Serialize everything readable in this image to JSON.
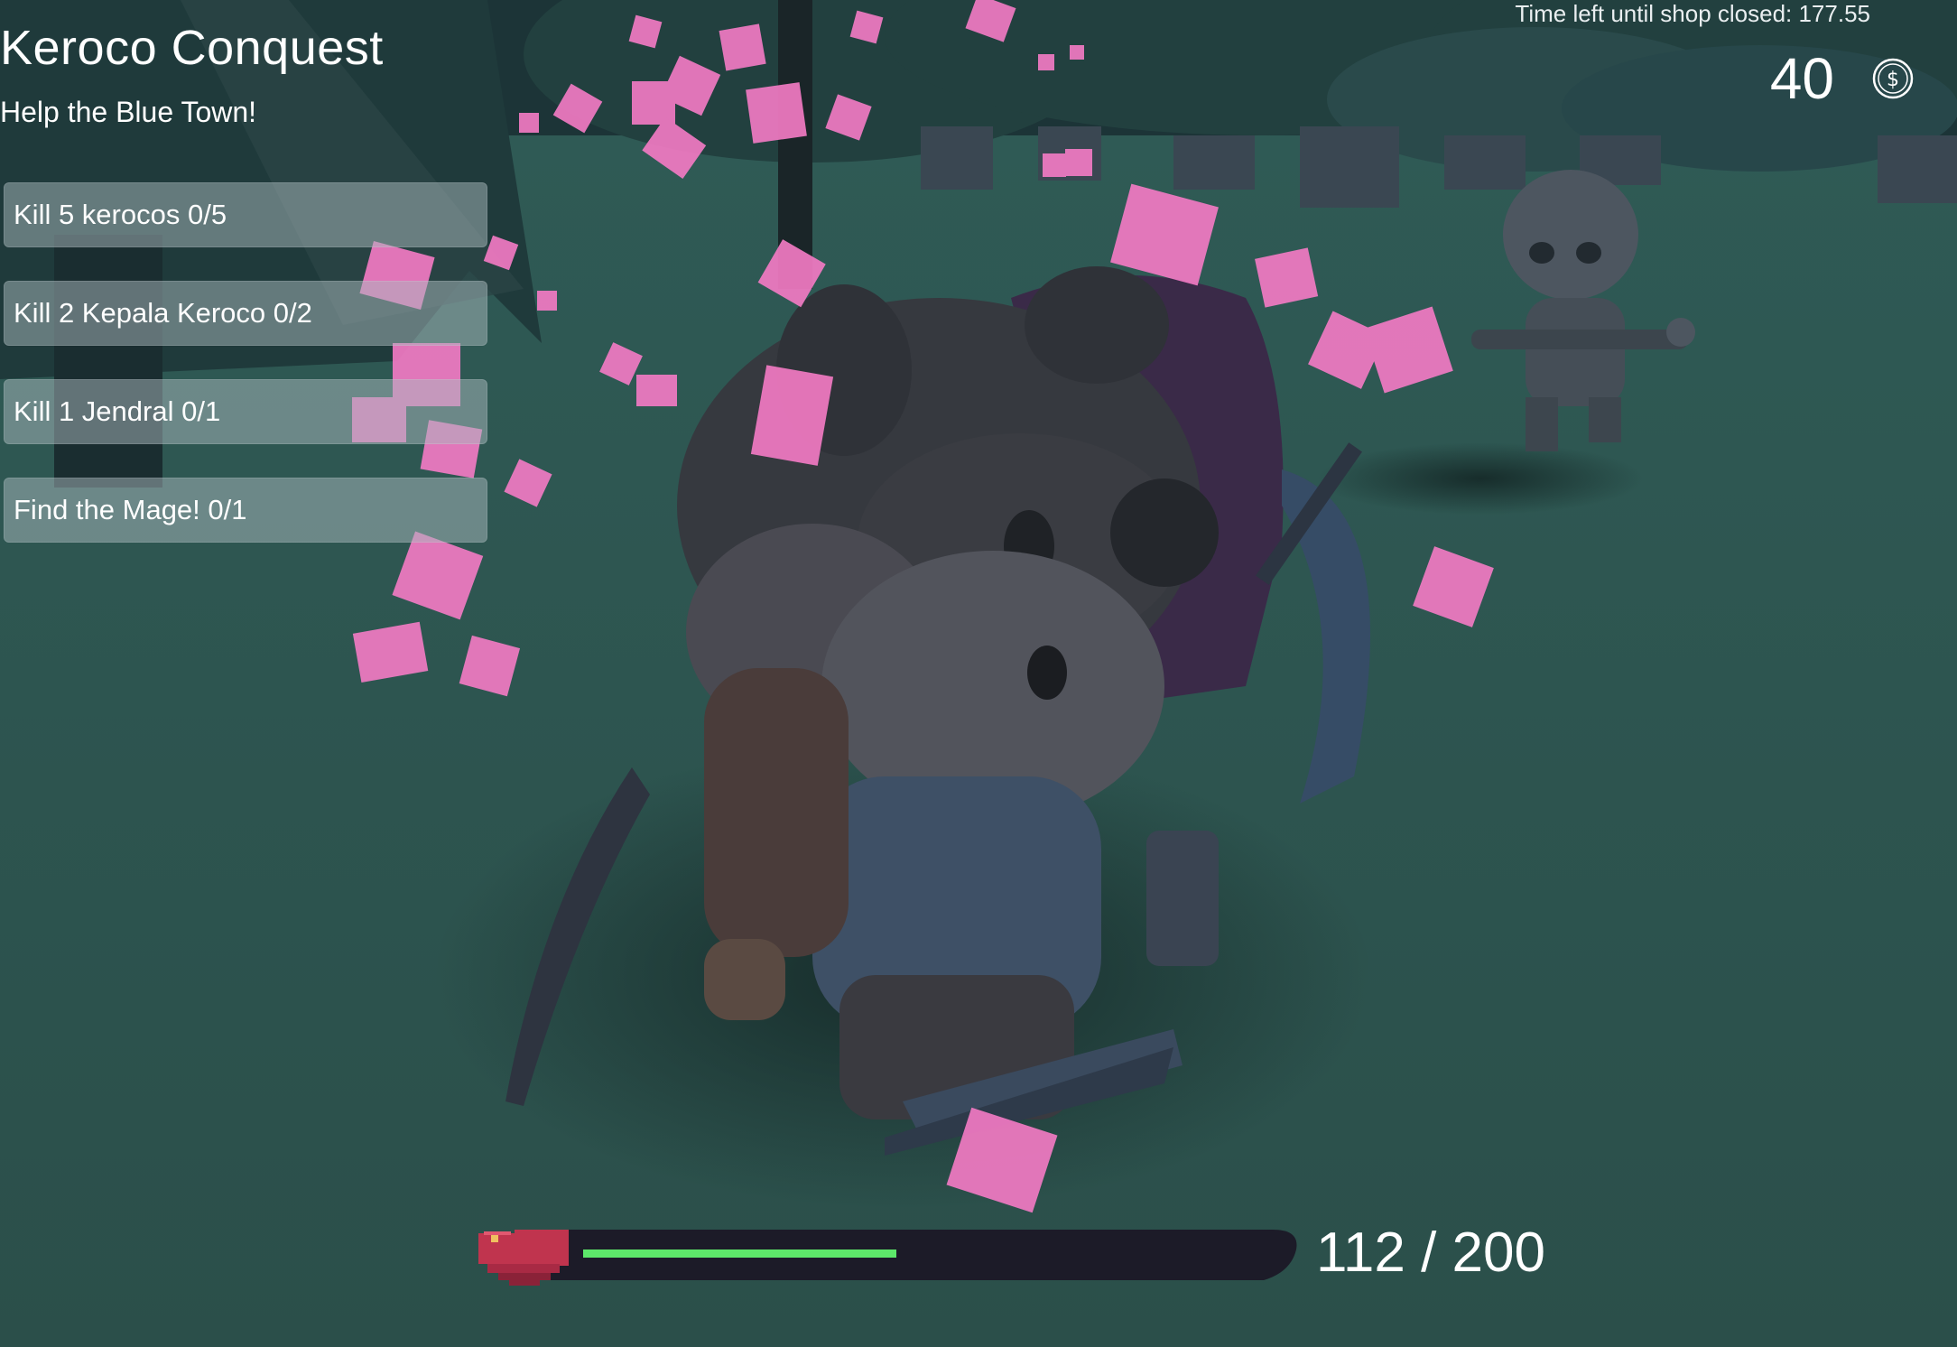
{
  "game": {
    "title": "Keroco Conquest",
    "subtitle": "Help the Blue Town!"
  },
  "quests": [
    {
      "label": "Kill 5 kerocos 0/5"
    },
    {
      "label": "Kill 2 Kepala Keroco 0/2"
    },
    {
      "label": "Kill 1 Jendral 0/1"
    },
    {
      "label": "Find the Mage! 0/1"
    }
  ],
  "shop": {
    "timer_label": "Time left until shop closed: 177.55"
  },
  "wallet": {
    "coins": "40",
    "icon": "dollar-coin-icon"
  },
  "health": {
    "current": 112,
    "max": 200,
    "text": "112 / 200",
    "fraction": 0.56,
    "icon": "heart-icon",
    "bar_color": "#5de86a"
  },
  "colors": {
    "ground": "#2d5550",
    "sky": "#1b3336",
    "particles": "#f27bc4"
  }
}
